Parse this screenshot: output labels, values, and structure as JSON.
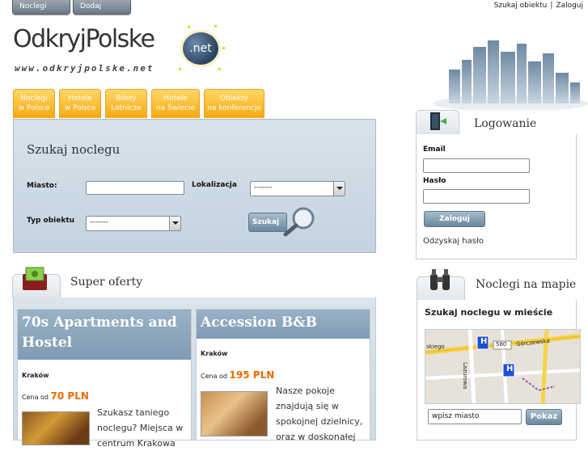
{
  "top_bar": {
    "buttons": [
      "Noclegi",
      "Dodaj obiekt"
    ],
    "links": [
      "Szukaj obiektu",
      "Zaloguj"
    ]
  },
  "logo": {
    "text": "OdkryjPolske",
    "tld": ".net",
    "subtitle": "www.odkryjpolske.net"
  },
  "tabs": [
    {
      "line1": "Noclegi",
      "line2": "w Polsce"
    },
    {
      "line1": "Hotele",
      "line2": "w Polsce"
    },
    {
      "line1": "Bilety",
      "line2": "Lotnicze"
    },
    {
      "line1": "Hotele",
      "line2": "na Świecie"
    },
    {
      "line1": "Obiekty",
      "line2": "na konferencje"
    }
  ],
  "search": {
    "title": "Szukaj noclegu",
    "city_label": "Miasto:",
    "city_value": "",
    "location_label": "Lokalizacja",
    "location_value": "-------",
    "type_label": "Typ obiektu",
    "type_value": "-------",
    "submit_label": "Szukaj"
  },
  "login": {
    "title": "Logowanie",
    "email_label": "Email",
    "email_value": "",
    "password_label": "Hasło",
    "password_value": "",
    "submit_label": "Zaloguj",
    "recover_link": "Odzyskaj hasło"
  },
  "offers": {
    "title": "Super oferty",
    "cards": [
      {
        "name": "70s Apartments and Hostel",
        "city": "Kraków",
        "price_prefix": "Cena od",
        "price": "70 PLN",
        "description": [
          "Szukasz taniego",
          "noclegu? Miejsca w",
          "centrum Krakowa"
        ]
      },
      {
        "name": "Accession B&B",
        "city": "Kraków",
        "price_prefix": "Cena od",
        "price": "195 PLN",
        "description": [
          "Nasze pokoje",
          "znajdują się w",
          "spokojnej dzielnicy,",
          "oraz w doskonałej"
        ]
      }
    ]
  },
  "map_box": {
    "title": "Noclegi na mapie",
    "subtitle": "Szukaj noclegu w mieście",
    "street_labels": [
      "Górczewska",
      "580",
      "skiego",
      "Lazurowa"
    ],
    "city_input_value": "wpisz miasto",
    "submit_label": "Pokaz"
  },
  "colors": {
    "accent_orange": "#f7a80f",
    "price_orange": "#ee6b00",
    "panel_blue": "#c4d3df",
    "card_header": "#8aa5bb"
  },
  "icons": [
    "globe-icon",
    "door-login-icon",
    "money-icon",
    "binoculars-icon",
    "magnifier-icon",
    "hotel-marker-icon"
  ]
}
